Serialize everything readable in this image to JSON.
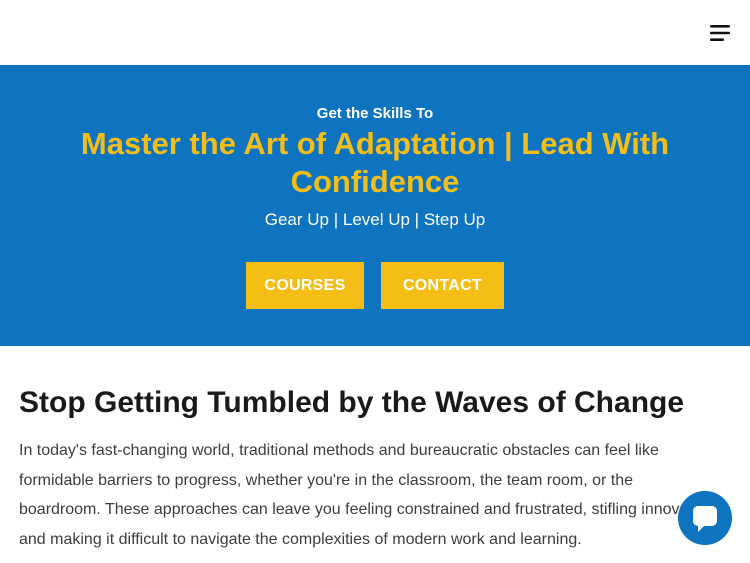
{
  "header": {
    "menu_icon": "hamburger-menu-icon"
  },
  "hero": {
    "eyebrow": "Get the Skills To",
    "headline": "Master the Art of Adaptation | Lead With Confidence",
    "tagline": "Gear Up | Level Up | Step Up",
    "buttons": {
      "courses": "COURSES",
      "contact": "CONTACT"
    }
  },
  "section": {
    "title": "Stop Getting Tumbled by the Waves of Change",
    "body": "In today's fast-changing world, traditional methods and bureaucratic obstacles can feel like formidable barriers to progress, whether you're in the classroom, the team room, or the boardroom. These approaches can leave you feeling constrained and frustrated, stifling innovation and making it difficult to navigate the complexities of modern work and learning."
  },
  "chat_widget": {
    "icon": "chat-bubble-icon"
  },
  "colors": {
    "hero_blue": "#0f74bf",
    "accent_yellow": "#f5be17",
    "heading_dark": "#1a1a1a",
    "body_text": "#3d3d3d"
  }
}
